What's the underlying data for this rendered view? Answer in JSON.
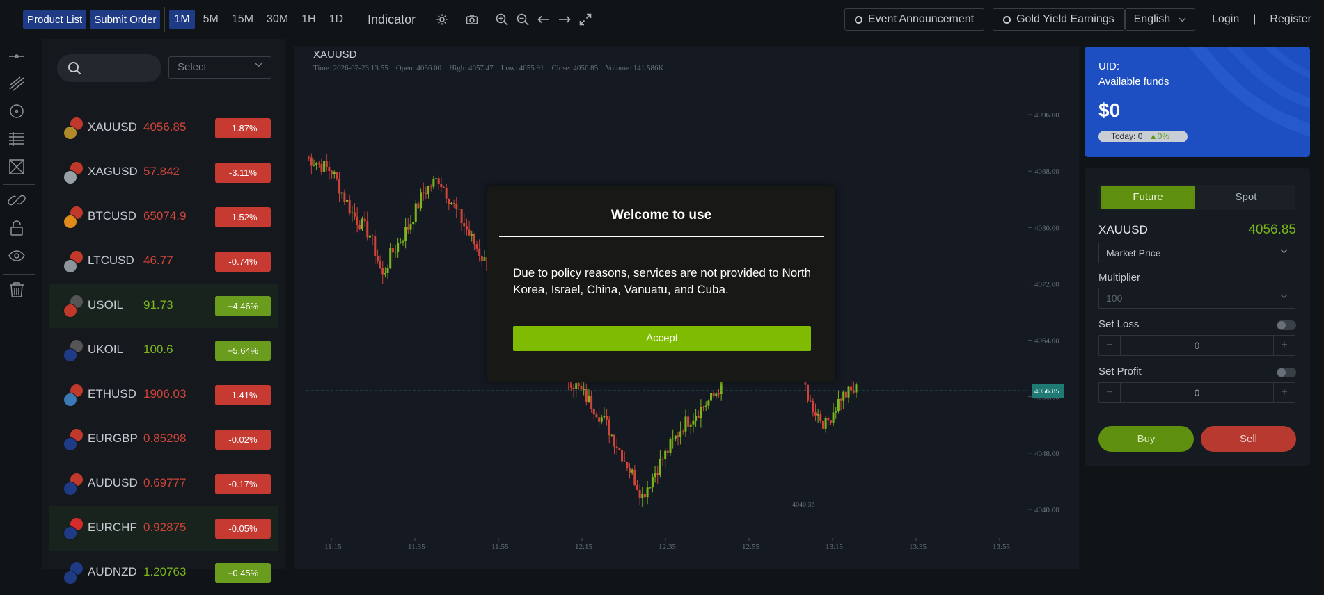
{
  "topbar": {
    "product_list": "Product List",
    "submit_order": "Submit Order",
    "timeframes": [
      "1M",
      "5M",
      "15M",
      "30M",
      "1H",
      "1D"
    ],
    "active_timeframe": "1M",
    "indicator": "Indicator",
    "event_announcement": "Event Announcement",
    "gold_yield": "Gold Yield Earnings",
    "language": "English",
    "login": "Login",
    "separator": "|",
    "register": "Register"
  },
  "product_list": {
    "search_placeholder": "",
    "select_placeholder": "Select",
    "items": [
      {
        "symbol": "XAUUSD",
        "price": "4056.85",
        "change": "-1.87%",
        "dir": "down",
        "highlight": false
      },
      {
        "symbol": "XAGUSD",
        "price": "57.842",
        "change": "-3.11%",
        "dir": "down",
        "highlight": false
      },
      {
        "symbol": "BTCUSD",
        "price": "65074.9",
        "change": "-1.52%",
        "dir": "down",
        "highlight": false
      },
      {
        "symbol": "LTCUSD",
        "price": "46.77",
        "change": "-0.74%",
        "dir": "down",
        "highlight": false
      },
      {
        "symbol": "USOIL",
        "price": "91.73",
        "change": "+4.46%",
        "dir": "up",
        "highlight": true
      },
      {
        "symbol": "UKOIL",
        "price": "100.6",
        "change": "+5.64%",
        "dir": "up",
        "highlight": false
      },
      {
        "symbol": "ETHUSD",
        "price": "1906.03",
        "change": "-1.41%",
        "dir": "down",
        "highlight": false
      },
      {
        "symbol": "EURGBP",
        "price": "0.85298",
        "change": "-0.02%",
        "dir": "down",
        "highlight": false
      },
      {
        "symbol": "AUDUSD",
        "price": "0.69777",
        "change": "-0.17%",
        "dir": "down",
        "highlight": false
      },
      {
        "symbol": "EURCHF",
        "price": "0.92875",
        "change": "-0.05%",
        "dir": "down",
        "highlight": true
      },
      {
        "symbol": "AUDNZD",
        "price": "1.20763",
        "change": "+0.45%",
        "dir": "up",
        "highlight": false
      }
    ]
  },
  "chart": {
    "symbol": "XAUUSD",
    "ohlc": {
      "time": "Time: 2026-07-23 13:55",
      "open": "Open: 4056.00",
      "high": "High: 4057.47",
      "low": "Low: 4055.91",
      "close": "Close: 4056.85",
      "volume": "Volume: 141.586K"
    },
    "y_ticks": [
      "4096.00",
      "4088.00",
      "4080.00",
      "4072.00",
      "4064.00",
      "4056.00",
      "4048.00",
      "4040.00"
    ],
    "x_ticks": [
      "11:15",
      "11:35",
      "11:55",
      "12:15",
      "12:35",
      "12:55",
      "13:15",
      "13:35",
      "13:55"
    ],
    "last_price_label": "4056.85",
    "low_marker_label": "4040.36",
    "colors": {
      "up": "#7bb61c",
      "down": "#d0443a",
      "last_price": "#1f7a74"
    }
  },
  "modal": {
    "title": "Welcome to use",
    "message": "Due to policy reasons, services are not provided to North Korea, Israel, China, Vanuatu, and Cuba.",
    "accept": "Accept"
  },
  "account": {
    "uid": "UID:",
    "available": "Available funds",
    "balance": "$0",
    "today": "Today: 0",
    "today_pct": "0%"
  },
  "trade": {
    "tab_future": "Future",
    "tab_spot": "Spot",
    "symbol": "XAUUSD",
    "price": "4056.85",
    "order_type": "Market Price",
    "multiplier_label": "Multiplier",
    "multiplier_value": "100",
    "set_loss": "Set Loss",
    "loss_value": "0",
    "set_profit": "Set Profit",
    "profit_value": "0",
    "minus": "−",
    "plus": "+",
    "buy": "Buy",
    "sell": "Sell"
  }
}
